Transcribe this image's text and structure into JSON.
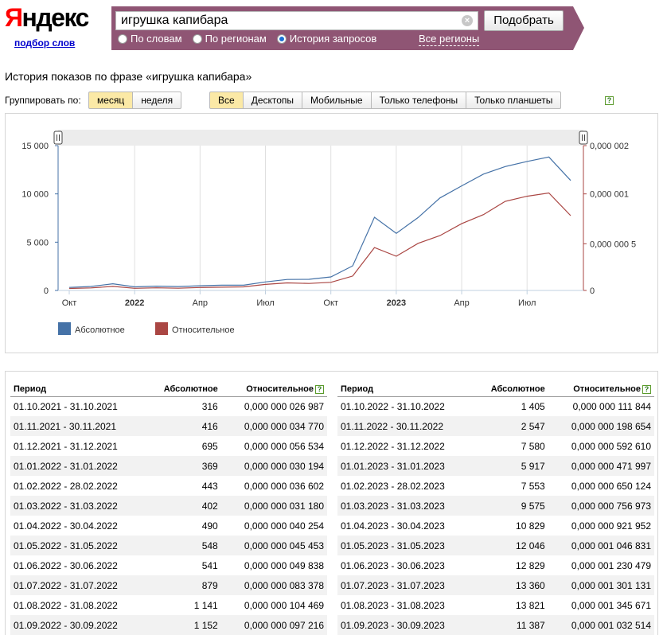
{
  "header": {
    "logo_text": "Яндекс",
    "logo_sub": "подбор слов",
    "search_value": "игрушка капибара",
    "submit_label": "Подобрать",
    "radios": [
      {
        "label": "По словам",
        "checked": false
      },
      {
        "label": "По регионам",
        "checked": false
      },
      {
        "label": "История запросов",
        "checked": true
      }
    ],
    "regions_link": "Все регионы"
  },
  "controls": {
    "title": "История показов по фразе «игрушка капибара»",
    "group_label": "Группировать по:",
    "group_options": [
      "месяц",
      "неделя"
    ],
    "group_active": "месяц",
    "device_options": [
      "Все",
      "Десктопы",
      "Мобильные",
      "Только телефоны",
      "Только планшеты"
    ],
    "device_active": "Все",
    "help_icon": "?"
  },
  "chart_data": {
    "type": "line",
    "x": [
      "Окт 2021",
      "Ноя 2021",
      "Дек 2021",
      "Янв 2022",
      "Фев 2022",
      "Мар 2022",
      "Апр 2022",
      "Май 2022",
      "Июн 2022",
      "Июл 2022",
      "Авг 2022",
      "Сен 2022",
      "Окт 2022",
      "Ноя 2022",
      "Дек 2022",
      "Янв 2023",
      "Фев 2023",
      "Мар 2023",
      "Апр 2023",
      "Май 2023",
      "Июн 2023",
      "Июл 2023",
      "Авг 2023",
      "Сен 2023"
    ],
    "series": [
      {
        "name": "Абсолютное",
        "color": "#4572a7",
        "axis": "left",
        "values": [
          316,
          416,
          695,
          369,
          443,
          402,
          490,
          548,
          541,
          879,
          1141,
          1152,
          1405,
          2547,
          7580,
          5917,
          7553,
          9575,
          10829,
          12046,
          12829,
          13360,
          13821,
          11387
        ]
      },
      {
        "name": "Относительное",
        "color": "#aa4643",
        "axis": "right",
        "values": [
          2.6987e-08,
          3.477e-08,
          5.6534e-08,
          3.0194e-08,
          3.6602e-08,
          3.118e-08,
          4.0254e-08,
          4.5453e-08,
          4.9838e-08,
          8.3378e-08,
          1.04469e-07,
          9.7216e-08,
          1.11844e-07,
          1.98654e-07,
          5.9261e-07,
          4.71997e-07,
          6.50124e-07,
          7.56973e-07,
          9.21952e-07,
          1.046831e-06,
          1.230479e-06,
          1.301131e-06,
          1.345671e-06,
          1.032514e-06
        ]
      }
    ],
    "y_left_ticks": [
      "15 000",
      "10 000",
      "5 000",
      "0"
    ],
    "y_left_lim": [
      0,
      15000
    ],
    "y_right_ticks": [
      "0,000 002",
      "0,000 001",
      "0,000 000 5",
      "0"
    ],
    "y_right_lim": [
      0,
      1.5e-06
    ],
    "x_ticks": [
      {
        "label": "Окт",
        "bold": false
      },
      {
        "label": "2022",
        "bold": true
      },
      {
        "label": "Апр",
        "bold": false
      },
      {
        "label": "Июл",
        "bold": false
      },
      {
        "label": "Окт",
        "bold": false
      },
      {
        "label": "2023",
        "bold": true
      },
      {
        "label": "Апр",
        "bold": false
      },
      {
        "label": "Июл",
        "bold": false
      }
    ],
    "legend": [
      "Абсолютное",
      "Относительное"
    ],
    "grid": true
  },
  "table": {
    "headers": [
      "Период",
      "Абсолютное",
      "Относительное"
    ],
    "left_rows": [
      [
        "01.10.2021 - 31.10.2021",
        "316",
        "0,000 000 026 987"
      ],
      [
        "01.11.2021 - 30.11.2021",
        "416",
        "0,000 000 034 770"
      ],
      [
        "01.12.2021 - 31.12.2021",
        "695",
        "0,000 000 056 534"
      ],
      [
        "01.01.2022 - 31.01.2022",
        "369",
        "0,000 000 030 194"
      ],
      [
        "01.02.2022 - 28.02.2022",
        "443",
        "0,000 000 036 602"
      ],
      [
        "01.03.2022 - 31.03.2022",
        "402",
        "0,000 000 031 180"
      ],
      [
        "01.04.2022 - 30.04.2022",
        "490",
        "0,000 000 040 254"
      ],
      [
        "01.05.2022 - 31.05.2022",
        "548",
        "0,000 000 045 453"
      ],
      [
        "01.06.2022 - 30.06.2022",
        "541",
        "0,000 000 049 838"
      ],
      [
        "01.07.2022 - 31.07.2022",
        "879",
        "0,000 000 083 378"
      ],
      [
        "01.08.2022 - 31.08.2022",
        "1 141",
        "0,000 000 104 469"
      ],
      [
        "01.09.2022 - 30.09.2022",
        "1 152",
        "0,000 000 097 216"
      ]
    ],
    "right_rows": [
      [
        "01.10.2022 - 31.10.2022",
        "1 405",
        "0,000 000 111 844"
      ],
      [
        "01.11.2022 - 30.11.2022",
        "2 547",
        "0,000 000 198 654"
      ],
      [
        "01.12.2022 - 31.12.2022",
        "7 580",
        "0,000 000 592 610"
      ],
      [
        "01.01.2023 - 31.01.2023",
        "5 917",
        "0,000 000 471 997"
      ],
      [
        "01.02.2023 - 28.02.2023",
        "7 553",
        "0,000 000 650 124"
      ],
      [
        "01.03.2023 - 31.03.2023",
        "9 575",
        "0,000 000 756 973"
      ],
      [
        "01.04.2023 - 30.04.2023",
        "10 829",
        "0,000 000 921 952"
      ],
      [
        "01.05.2023 - 31.05.2023",
        "12 046",
        "0,000 001 046 831"
      ],
      [
        "01.06.2023 - 30.06.2023",
        "12 829",
        "0,000 001 230 479"
      ],
      [
        "01.07.2023 - 31.07.2023",
        "13 360",
        "0,000 001 301 131"
      ],
      [
        "01.08.2023 - 31.08.2023",
        "13 821",
        "0,000 001 345 671"
      ],
      [
        "01.09.2023 - 30.09.2023",
        "11 387",
        "0,000 001 032 514"
      ]
    ]
  }
}
